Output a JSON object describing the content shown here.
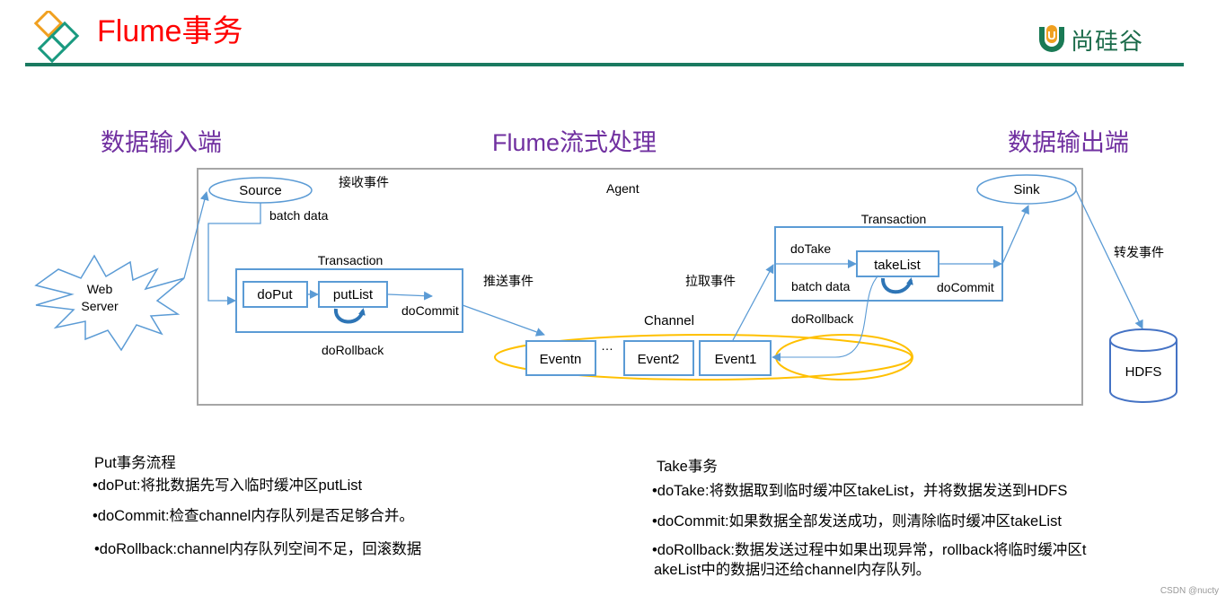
{
  "header": {
    "title": "Flume事务",
    "logo_text": "尚硅谷",
    "logo_letter": "U",
    "colors": {
      "title": "#ff0000",
      "rule": "#1a7a60",
      "heading": "#7030a0",
      "line": "#5b9bd5",
      "channel": "#ffc000"
    }
  },
  "sections": {
    "input": "数据输入端",
    "process": "Flume流式处理",
    "output": "数据输出端"
  },
  "diagram": {
    "web_server": [
      "Web",
      "Server"
    ],
    "agent_label": "Agent",
    "source": "Source",
    "receive_event": "接收事件",
    "batch_data_source": "batch data",
    "put_transaction": {
      "title": "Transaction",
      "do_put": "doPut",
      "put_list": "putList",
      "do_commit": "doCommit",
      "do_rollback": "doRollback"
    },
    "push_event": "推送事件",
    "pull_event": "拉取事件",
    "channel": {
      "title": "Channel",
      "events": [
        "Eventn",
        "Event2",
        "Event1"
      ],
      "ellipsis": "…"
    },
    "take_transaction": {
      "title": "Transaction",
      "do_take": "doTake",
      "take_list": "takeList",
      "batch_data": "batch data",
      "do_commit": "doCommit",
      "do_rollback": "doRollback"
    },
    "sink": "Sink",
    "forward_event": "转发事件",
    "hdfs": "HDFS"
  },
  "put_notes": {
    "heading": "Put事务流程",
    "items": [
      "•doPut:将批数据先写入临时缓冲区putList",
      "•doCommit:检查channel内存队列是否足够合并。",
      "•doRollback:channel内存队列空间不足，回滚数据"
    ]
  },
  "take_notes": {
    "heading": "Take事务",
    "items": [
      "•doTake:将数据取到临时缓冲区takeList，并将数据发送到HDFS",
      "•doCommit:如果数据全部发送成功，则清除临时缓冲区takeList",
      "•doRollback:数据发送过程中如果出现异常，rollback将临时缓冲区t",
      "akeList中的数据归还给channel内存队列。"
    ]
  },
  "watermark": "CSDN @nucty"
}
